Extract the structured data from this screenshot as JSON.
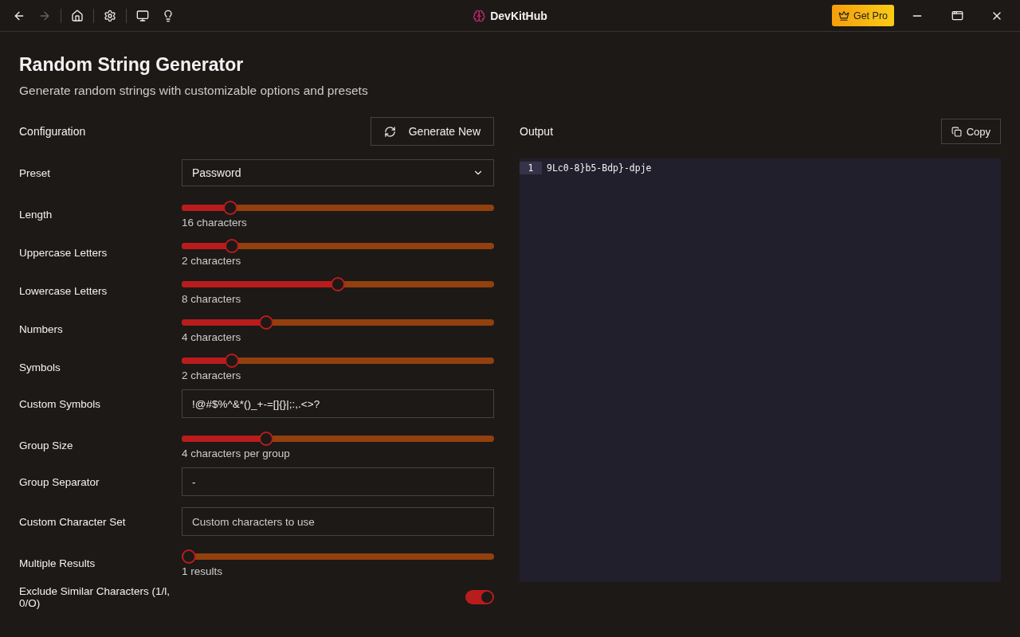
{
  "titlebar": {
    "app_name": "DevKitHub",
    "pro_button": "Get Pro",
    "forward_disabled": true
  },
  "page": {
    "title": "Random String Generator",
    "subtitle": "Generate random strings with customizable options and presets"
  },
  "config": {
    "heading": "Configuration",
    "generate_button": "Generate New",
    "rows": [
      {
        "kind": "select",
        "label": "Preset",
        "value": "Password"
      },
      {
        "kind": "slider",
        "label": "Length",
        "level": 0.14,
        "reading": "16 characters"
      },
      {
        "kind": "slider",
        "label": "Uppercase Letters",
        "level": 0.145,
        "reading": "2 characters"
      },
      {
        "kind": "slider",
        "label": "Lowercase Letters",
        "level": 0.5,
        "reading": "8 characters"
      },
      {
        "kind": "slider",
        "label": "Numbers",
        "level": 0.26,
        "reading": "4 characters"
      },
      {
        "kind": "slider",
        "label": "Symbols",
        "level": 0.145,
        "reading": "2 characters"
      },
      {
        "kind": "input",
        "label": "Custom Symbols",
        "value": "!@#$%^&*()_+-=[]{}|;:,.<>?"
      },
      {
        "kind": "slider",
        "label": "Group Size",
        "level": 0.26,
        "reading": "4 characters per group"
      },
      {
        "kind": "input",
        "label": "Group Separator",
        "value": "-"
      },
      {
        "kind": "input",
        "label": "Custom Character Set",
        "placeholder": "Custom characters to use"
      },
      {
        "kind": "slider",
        "label": "Multiple Results",
        "level": 0,
        "reading": "1 results"
      },
      {
        "kind": "toggle",
        "label": "Exclude Similar Characters (1/l, 0/O)",
        "on": true
      }
    ]
  },
  "output": {
    "heading": "Output",
    "copy_button": "Copy",
    "lines": [
      {
        "number": "1",
        "text": "9Lc0-8}b5-Bdp}-dpje"
      }
    ]
  }
}
